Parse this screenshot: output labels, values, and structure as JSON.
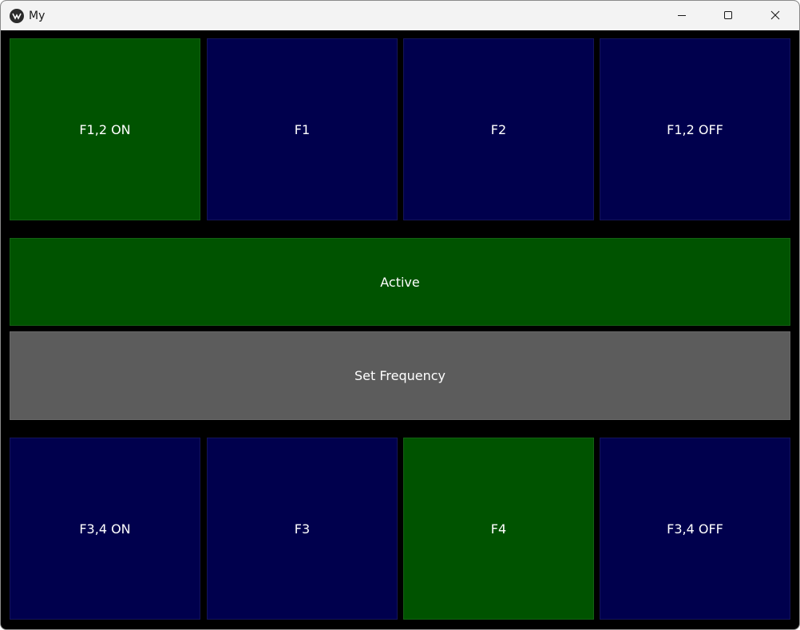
{
  "window": {
    "title": "My",
    "app_icon": "kivy-logo-icon",
    "controls": {
      "minimize": "minimize-icon",
      "maximize": "maximize-icon",
      "close": "close-icon"
    }
  },
  "colors": {
    "active_green": "#005300",
    "inactive_navy": "#00004d",
    "neutral_grey": "#5c5c5c",
    "background": "#000000"
  },
  "top_row": [
    {
      "label": "F1,2 ON",
      "state": "active"
    },
    {
      "label": "F1",
      "state": "inactive"
    },
    {
      "label": "F2",
      "state": "inactive"
    },
    {
      "label": "F1,2 OFF",
      "state": "inactive"
    }
  ],
  "status_button": {
    "label": "Active"
  },
  "set_frequency_button": {
    "label": "Set Frequency"
  },
  "bottom_row": [
    {
      "label": "F3,4 ON",
      "state": "inactive"
    },
    {
      "label": "F3",
      "state": "inactive"
    },
    {
      "label": "F4",
      "state": "active"
    },
    {
      "label": "F3,4 OFF",
      "state": "inactive"
    }
  ]
}
